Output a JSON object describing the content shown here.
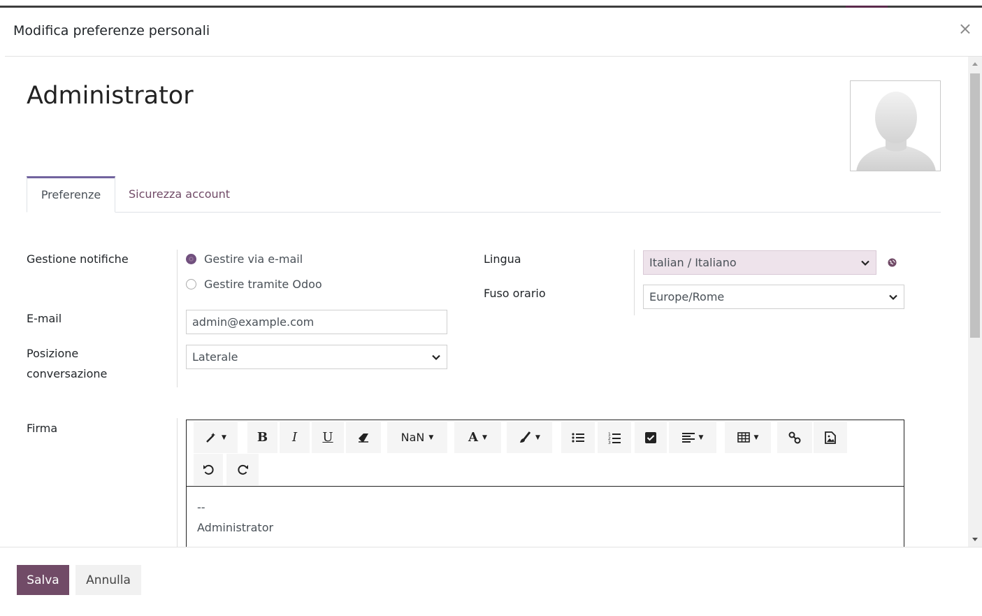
{
  "dialog": {
    "title": "Modifica preferenze personali",
    "close_symbol": "×"
  },
  "record": {
    "name": "Administrator"
  },
  "tabs": [
    {
      "label": "Preferenze",
      "active": true
    },
    {
      "label": "Sicurezza account",
      "active": false
    }
  ],
  "fields": {
    "notification_label": "Gestione notifiche",
    "notification_options": [
      {
        "label": "Gestire via e-mail",
        "checked": true
      },
      {
        "label": "Gestire tramite Odoo",
        "checked": false
      }
    ],
    "email_label": "E-mail",
    "email_value": "admin@example.com",
    "chat_position_label_line1": "Posizione",
    "chat_position_label_line2": "conversazione",
    "chat_position_value": "Laterale",
    "language_label": "Lingua",
    "language_value": "Italian / Italiano",
    "timezone_label": "Fuso orario",
    "timezone_value": "Europe/Rome",
    "signature_label": "Firma"
  },
  "editor": {
    "toolbar": {
      "bold": "B",
      "italic": "I",
      "underline": "U",
      "font_size": "NaN",
      "font_color": "A"
    },
    "content_line1": "--",
    "content_line2": "Administrator"
  },
  "footer": {
    "save_label": "Salva",
    "cancel_label": "Annulla"
  },
  "colors": {
    "brand": "#714b67",
    "language_field_bg": "#eee3eb"
  }
}
